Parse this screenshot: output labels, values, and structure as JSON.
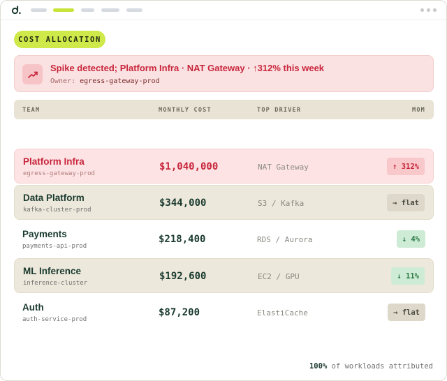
{
  "titlebar": {
    "tabs": [
      {
        "name": "tab-1",
        "active": false
      },
      {
        "name": "tab-2",
        "active": true
      },
      {
        "name": "tab-3",
        "active": false
      },
      {
        "name": "tab-4",
        "active": false
      },
      {
        "name": "tab-5",
        "active": false
      }
    ]
  },
  "section_chip": "COST ALLOCATION",
  "alert": {
    "title": "Spike detected; Platform Infra · NAT Gateway · ↑312% this week",
    "owner_label": "Owner:",
    "owner_value": "egress-gateway-prod",
    "icon": "trending-up-icon"
  },
  "table": {
    "headers": {
      "team": "TEAM",
      "cost": "MONTHLY COST",
      "driver": "TOP DRIVER",
      "mom": "MOM"
    },
    "rows": [
      {
        "team": "Platform Infra",
        "service": "egress-gateway-prod",
        "cost": "$1,040,000",
        "driver": "NAT Gateway",
        "mom": "↑ 312%",
        "trend": "up"
      },
      {
        "team": "Data Platform",
        "service": "kafka-cluster-prod",
        "cost": "$344,000",
        "driver": "S3 / Kafka",
        "mom": "→ flat",
        "trend": "flat"
      },
      {
        "team": "Payments",
        "service": "payments-api-prod",
        "cost": "$218,400",
        "driver": "RDS / Aurora",
        "mom": "↓ 4%",
        "trend": "down"
      },
      {
        "team": "ML Inference",
        "service": "inference-cluster",
        "cost": "$192,600",
        "driver": "EC2 / GPU",
        "mom": "↓ 11%",
        "trend": "down"
      },
      {
        "team": "Auth",
        "service": "auth-service-prod",
        "cost": "$87,200",
        "driver": "ElastiCache",
        "mom": "→ flat",
        "trend": "flat"
      }
    ]
  },
  "footer": {
    "percent": "100%",
    "text": " of workloads attributed"
  },
  "colors": {
    "accent": "#cfe84a",
    "alert": "#c8263c",
    "positive": "#2d7a45"
  }
}
